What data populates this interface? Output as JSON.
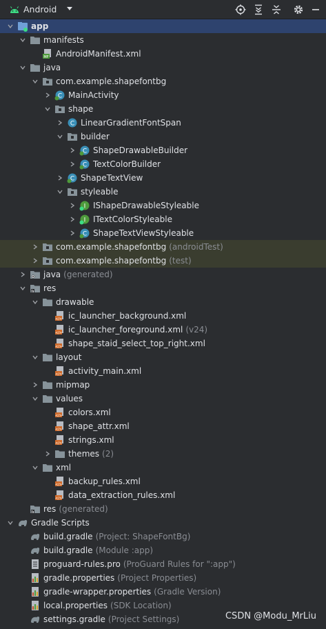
{
  "toolbar": {
    "title": "Android",
    "icons": [
      "locate-icon",
      "expand-all-icon",
      "collapse-all-icon",
      "settings-icon",
      "minimize-icon"
    ]
  },
  "tree": [
    {
      "label": "app",
      "suffix": "",
      "depth": 0,
      "arrow": "down",
      "icon": "module",
      "bold": true,
      "selected": true
    },
    {
      "label": "manifests",
      "suffix": "",
      "depth": 1,
      "arrow": "down",
      "icon": "folder"
    },
    {
      "label": "AndroidManifest.xml",
      "suffix": "",
      "depth": 2,
      "arrow": "",
      "icon": "manifest"
    },
    {
      "label": "java",
      "suffix": "",
      "depth": 1,
      "arrow": "down",
      "icon": "folder"
    },
    {
      "label": "com.example.shapefontbg",
      "suffix": "",
      "depth": 2,
      "arrow": "down",
      "icon": "package"
    },
    {
      "label": "MainActivity",
      "suffix": "",
      "depth": 3,
      "arrow": "right",
      "icon": "class-g"
    },
    {
      "label": "shape",
      "suffix": "",
      "depth": 3,
      "arrow": "down",
      "icon": "package"
    },
    {
      "label": "LinearGradientFontSpan",
      "suffix": "",
      "depth": 4,
      "arrow": "right",
      "icon": "class"
    },
    {
      "label": "builder",
      "suffix": "",
      "depth": 4,
      "arrow": "down",
      "icon": "package"
    },
    {
      "label": "ShapeDrawableBuilder",
      "suffix": "",
      "depth": 5,
      "arrow": "right",
      "icon": "class-g"
    },
    {
      "label": "TextColorBuilder",
      "suffix": "",
      "depth": 5,
      "arrow": "right",
      "icon": "class-g"
    },
    {
      "label": "ShapeTextView",
      "suffix": "",
      "depth": 4,
      "arrow": "right",
      "icon": "class-g"
    },
    {
      "label": "styleable",
      "suffix": "",
      "depth": 4,
      "arrow": "down",
      "icon": "package"
    },
    {
      "label": "IShapeDrawableStyleable",
      "suffix": "",
      "depth": 5,
      "arrow": "right",
      "icon": "interface"
    },
    {
      "label": "ITextColorStyleable",
      "suffix": "",
      "depth": 5,
      "arrow": "right",
      "icon": "interface"
    },
    {
      "label": "ShapeTextViewStyleable",
      "suffix": "",
      "depth": 5,
      "arrow": "right",
      "icon": "class-g"
    },
    {
      "label": "com.example.shapefontbg",
      "suffix": "(androidTest)",
      "depth": 2,
      "arrow": "right",
      "icon": "package",
      "hl": true
    },
    {
      "label": "com.example.shapefontbg",
      "suffix": "(test)",
      "depth": 2,
      "arrow": "right",
      "icon": "package",
      "hl": true
    },
    {
      "label": "java",
      "suffix": "(generated)",
      "depth": 1,
      "arrow": "right",
      "icon": "folder-gen"
    },
    {
      "label": "res",
      "suffix": "",
      "depth": 1,
      "arrow": "down",
      "icon": "folder-res"
    },
    {
      "label": "drawable",
      "suffix": "",
      "depth": 2,
      "arrow": "down",
      "icon": "folder"
    },
    {
      "label": "ic_launcher_background.xml",
      "suffix": "",
      "depth": 3,
      "arrow": "",
      "icon": "xml"
    },
    {
      "label": "ic_launcher_foreground.xml",
      "suffix": "(v24)",
      "depth": 3,
      "arrow": "",
      "icon": "xml"
    },
    {
      "label": "shape_staid_select_top_right.xml",
      "suffix": "",
      "depth": 3,
      "arrow": "",
      "icon": "xml"
    },
    {
      "label": "layout",
      "suffix": "",
      "depth": 2,
      "arrow": "down",
      "icon": "folder"
    },
    {
      "label": "activity_main.xml",
      "suffix": "",
      "depth": 3,
      "arrow": "",
      "icon": "xml"
    },
    {
      "label": "mipmap",
      "suffix": "",
      "depth": 2,
      "arrow": "right",
      "icon": "folder"
    },
    {
      "label": "values",
      "suffix": "",
      "depth": 2,
      "arrow": "down",
      "icon": "folder"
    },
    {
      "label": "colors.xml",
      "suffix": "",
      "depth": 3,
      "arrow": "",
      "icon": "xml"
    },
    {
      "label": "shape_attr.xml",
      "suffix": "",
      "depth": 3,
      "arrow": "",
      "icon": "xml"
    },
    {
      "label": "strings.xml",
      "suffix": "",
      "depth": 3,
      "arrow": "",
      "icon": "xml"
    },
    {
      "label": "themes",
      "suffix": "(2)",
      "depth": 3,
      "arrow": "right",
      "icon": "folder"
    },
    {
      "label": "xml",
      "suffix": "",
      "depth": 2,
      "arrow": "down",
      "icon": "folder"
    },
    {
      "label": "backup_rules.xml",
      "suffix": "",
      "depth": 3,
      "arrow": "",
      "icon": "xml"
    },
    {
      "label": "data_extraction_rules.xml",
      "suffix": "",
      "depth": 3,
      "arrow": "",
      "icon": "xml"
    },
    {
      "label": "res",
      "suffix": "(generated)",
      "depth": 1,
      "arrow": "",
      "icon": "folder-res"
    },
    {
      "label": "Gradle Scripts",
      "suffix": "",
      "depth": 0,
      "arrow": "down",
      "icon": "gradle"
    },
    {
      "label": "build.gradle",
      "suffix": "(Project: ShapeFontBg)",
      "depth": 1,
      "arrow": "",
      "icon": "gradle"
    },
    {
      "label": "build.gradle",
      "suffix": "(Module :app)",
      "depth": 1,
      "arrow": "",
      "icon": "gradle"
    },
    {
      "label": "proguard-rules.pro",
      "suffix": "(ProGuard Rules for \":app\")",
      "depth": 1,
      "arrow": "",
      "icon": "text-file"
    },
    {
      "label": "gradle.properties",
      "suffix": "(Project Properties)",
      "depth": 1,
      "arrow": "",
      "icon": "properties"
    },
    {
      "label": "gradle-wrapper.properties",
      "suffix": "(Gradle Version)",
      "depth": 1,
      "arrow": "",
      "icon": "properties"
    },
    {
      "label": "local.properties",
      "suffix": "(SDK Location)",
      "depth": 1,
      "arrow": "",
      "icon": "properties"
    },
    {
      "label": "settings.gradle",
      "suffix": "(Project Settings)",
      "depth": 1,
      "arrow": "",
      "icon": "gradle"
    }
  ],
  "watermark": "CSDN @Modu_MrLiu"
}
